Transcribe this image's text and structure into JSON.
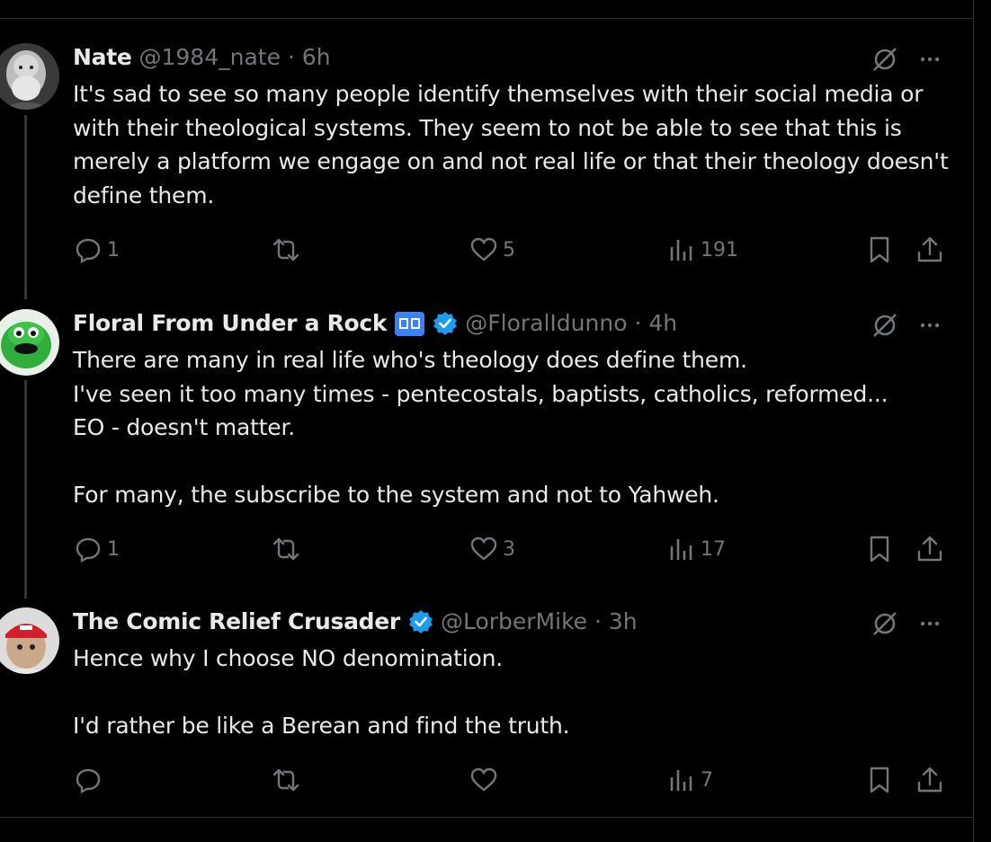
{
  "posts": [
    {
      "name": "Nate",
      "handle": "@1984_nate · 6h",
      "text": "It's sad to see so many people identify themselves with their social media or with their theological systems.  They seem to not be able to see that this is merely a platform we engage on and not real life or that their theology doesn't define them.",
      "replies": "1",
      "reposts": "",
      "likes": "5",
      "views": "191",
      "verified": false
    },
    {
      "name": "Floral From Under a Rock",
      "handle": "@FloralIdunno · 4h",
      "text": "There are many in real life who's theology does define them.\nI've seen it too many times - pentecostals, baptists, catholics, reformed...\nEO - doesn't matter.\n\nFor many, the subscribe to the system and not to Yahweh.",
      "replies": "1",
      "reposts": "",
      "likes": "3",
      "views": "17",
      "verified": true
    },
    {
      "name": "The Comic Relief Crusader",
      "handle": "@LorberMike · 3h",
      "text": "Hence why I choose NO denomination.\n\nI'd rather be like a Berean and find the truth.",
      "replies": "",
      "reposts": "",
      "likes": "",
      "views": "7",
      "verified": true
    }
  ],
  "icons": {
    "reply": "reply-icon",
    "repost": "repost-icon",
    "like": "heart-icon",
    "views": "views-icon",
    "bookmark": "bookmark-icon",
    "share": "share-icon",
    "grok": "grok-icon",
    "more": "more-icon"
  },
  "colors": {
    "background": "#000000",
    "text": "#e7e9ea",
    "muted": "#71767b",
    "verified": "#1d9bf0",
    "divider": "#2f3336"
  }
}
